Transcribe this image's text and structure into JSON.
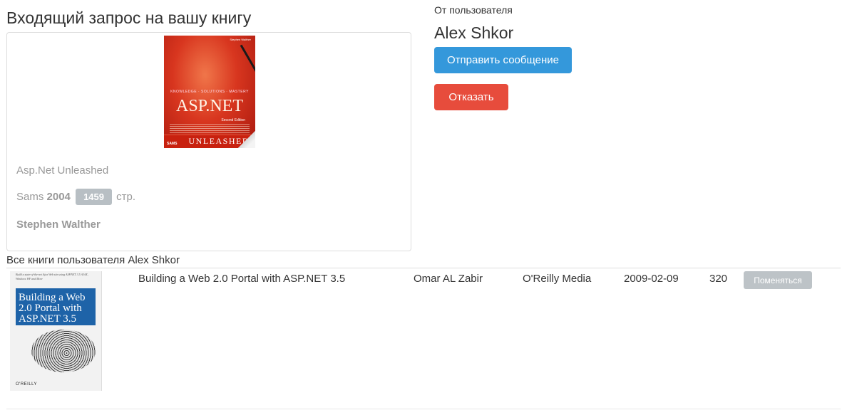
{
  "header": {
    "title": "Входящий запрос на вашу книгу"
  },
  "requested_book": {
    "title": "Asp.Net Unleashed",
    "publisher": "Sams",
    "year": "2004",
    "pages": "1459",
    "pages_unit": "стр.",
    "author": "Stephen Walther",
    "cover": {
      "author_line": "Stephen Walther",
      "tagline": "KNOWLEDGE · SOLUTIONS · MASTERY",
      "title": "ASP.NET",
      "edition": "Second Edition",
      "series": "UNLEASHED",
      "publisher_logo": "SAMS"
    }
  },
  "requester": {
    "from_label": "От пользователя",
    "name": "Alex Shkor",
    "send_message_label": "Отправить сообщение",
    "decline_label": "Отказать"
  },
  "user_books": {
    "heading": "Все книги пользователя Alex Shkor",
    "rows": [
      {
        "title": "Building a Web 2.0 Portal with ASP.NET 3.5",
        "author": "Omar AL Zabir",
        "publisher": "O'Reilly Media",
        "date": "2009-02-09",
        "pages": "320",
        "action_label": "Поменяться",
        "cover": {
          "blurb": "Build a state-of-the-art Ajax Web site using ASP.NET 3.5 AJAX, Windows WF and More",
          "title": "Building a Web 2.0 Portal with ASP.NET 3.5",
          "publisher_logo": "O'REILLY"
        }
      }
    ]
  },
  "colors": {
    "primary": "#3498db",
    "danger": "#e74c3c",
    "muted_badge": "#b8bfc4",
    "disabled_button": "#bdc3c7"
  }
}
